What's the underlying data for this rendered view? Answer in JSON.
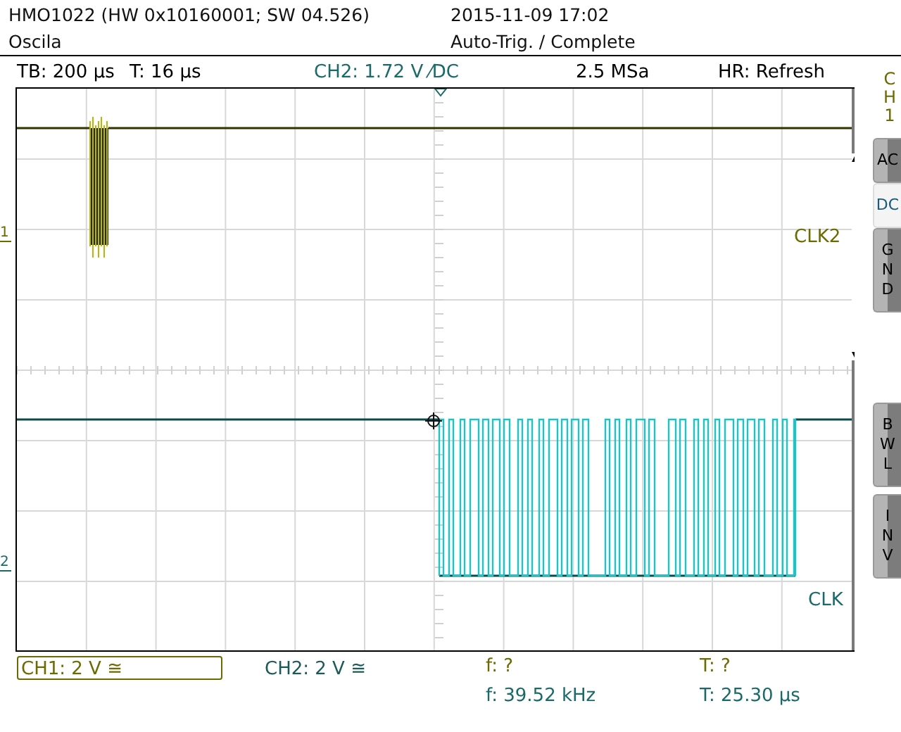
{
  "header": {
    "instrument": "HMO1022 (HW 0x10160001; SW 04.526)",
    "mode": "Oscila",
    "datetime": "2015-11-09 17:02",
    "status": "Auto-Trig. / Complete"
  },
  "info_bar": [
    {
      "text": "TB: 200 µs",
      "color": "#000000"
    },
    {
      "text": "T: 16 µs",
      "color": "#000000"
    },
    {
      "text": "CH2: 1.72 V ⁄DC",
      "color": "#1a6a6a"
    },
    {
      "text": "2.5 MSa",
      "color": "#000000"
    },
    {
      "text": "HR: Refresh",
      "color": "#000000"
    }
  ],
  "traces": [
    {
      "label": "CLK2",
      "marker": "1",
      "color": "#6b6b00"
    },
    {
      "label": "CLK",
      "marker": "2",
      "color": "#1a6a6a"
    }
  ],
  "side_panel": {
    "channel_label": "CH1",
    "coupling_buttons": [
      {
        "label": "AC",
        "selected": false
      },
      {
        "label": "DC",
        "selected": true
      },
      {
        "label": "GND",
        "selected": false
      }
    ],
    "function_buttons": [
      {
        "label": "BWL"
      },
      {
        "label": "INV"
      }
    ]
  },
  "channel_readouts": [
    {
      "text": "CH1: 2 V ≅",
      "selected": true,
      "color": "#6b6b00"
    },
    {
      "text": "CH2: 2 V ≅",
      "selected": false,
      "color": "#1a5a5a"
    }
  ],
  "measurements": [
    {
      "text": "f: ?",
      "color": "#6b6b00"
    },
    {
      "text": "T: ?",
      "color": "#6b6b00"
    },
    {
      "text": "f: 39.52 kHz",
      "color": "#1a6a6a"
    },
    {
      "text": "T: 25.30 µs",
      "color": "#1a6a6a"
    }
  ]
}
